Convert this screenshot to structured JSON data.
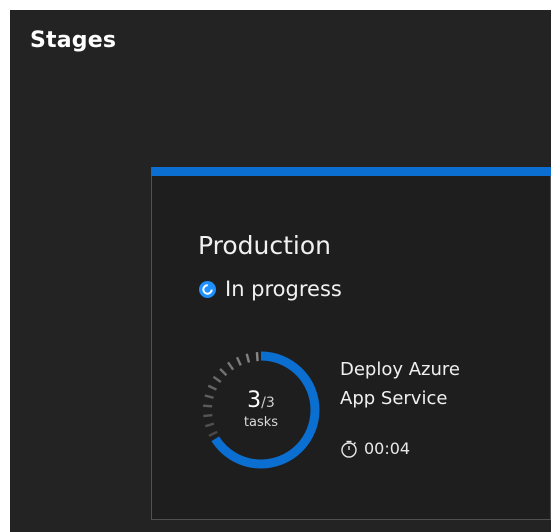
{
  "page": {
    "section_title": "Stages"
  },
  "stage": {
    "name": "Production",
    "status": "In progress",
    "accent_color": "#0a6fd1",
    "status_color": "#1e90ff",
    "tasks": {
      "completed": "3",
      "separator": "/",
      "total": "3",
      "label": "tasks",
      "progress_fraction": 1.0
    },
    "current_task": {
      "line1": "Deploy Azure",
      "line2": "App Service"
    },
    "duration": "00:04",
    "icons": {
      "status": "in-progress-icon",
      "duration": "timer-icon"
    }
  }
}
